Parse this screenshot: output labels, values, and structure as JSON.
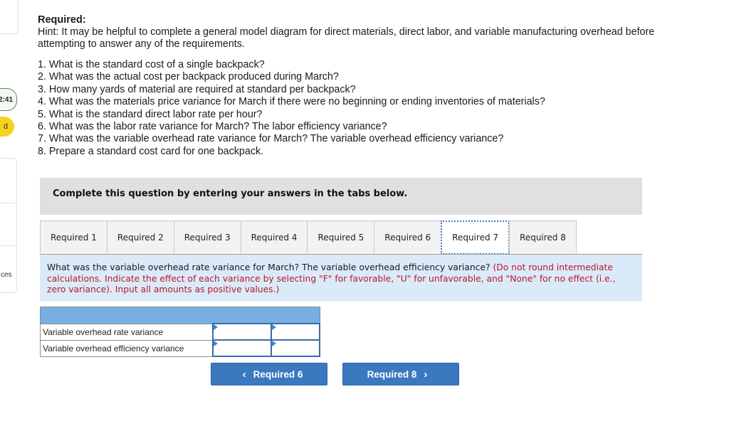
{
  "sidebar": {
    "timer": "2:41",
    "status": "d",
    "nav_item_1": ":",
    "nav_item_3": "ces"
  },
  "header": {
    "title": "Required:",
    "hint": "Hint:  It may be helpful to complete a general model diagram for direct materials, direct labor, and variable manufacturing overhead before attempting to answer any of the requirements."
  },
  "questions": [
    "1. What is the standard cost of a single backpack?",
    "2. What was the actual cost per backpack produced during March?",
    "3. How many yards of material are required at standard per backpack?",
    "4. What was the materials price variance for March if there were no beginning or ending inventories of materials?",
    "5. What is the standard direct labor rate per hour?",
    "6. What was the labor rate variance for March? The labor efficiency variance?",
    "7. What was the variable overhead rate variance for March? The variable overhead efficiency variance?",
    "8. Prepare a standard cost card for one backpack."
  ],
  "instruction": "Complete this question by entering your answers in the tabs below.",
  "tabs": [
    {
      "label": "Required 1",
      "active": false
    },
    {
      "label": "Required 2",
      "active": false
    },
    {
      "label": "Required 3",
      "active": false
    },
    {
      "label": "Required 4",
      "active": false
    },
    {
      "label": "Required 5",
      "active": false
    },
    {
      "label": "Required 6",
      "active": false
    },
    {
      "label": "Required 7",
      "active": true
    },
    {
      "label": "Required 8",
      "active": false
    }
  ],
  "prompt": {
    "question": "What was the variable overhead rate variance for March? The variable overhead efficiency variance? ",
    "instruction": "(Do not round intermediate calculations. Indicate the effect of each variance by selecting \"F\" for favorable, \"U\" for unfavorable, and \"None\" for no effect (i.e., zero variance). Input all amounts as positive values.)"
  },
  "answer_table": {
    "rows": [
      {
        "label": "Variable overhead rate variance",
        "amount": "",
        "effect": ""
      },
      {
        "label": "Variable overhead efficiency variance",
        "amount": "",
        "effect": ""
      }
    ]
  },
  "navigation": {
    "prev_label": "Required 6",
    "next_label": "Required 8",
    "prev_icon": "‹",
    "next_icon": "›"
  },
  "colors": {
    "accent": "#3a78c0",
    "table_header": "#77aee3",
    "prompt_bg": "#dbeaf8",
    "instruction_red": "#b8182a",
    "timer_border": "#5a8a50",
    "status_yellow": "#f7d21b"
  }
}
